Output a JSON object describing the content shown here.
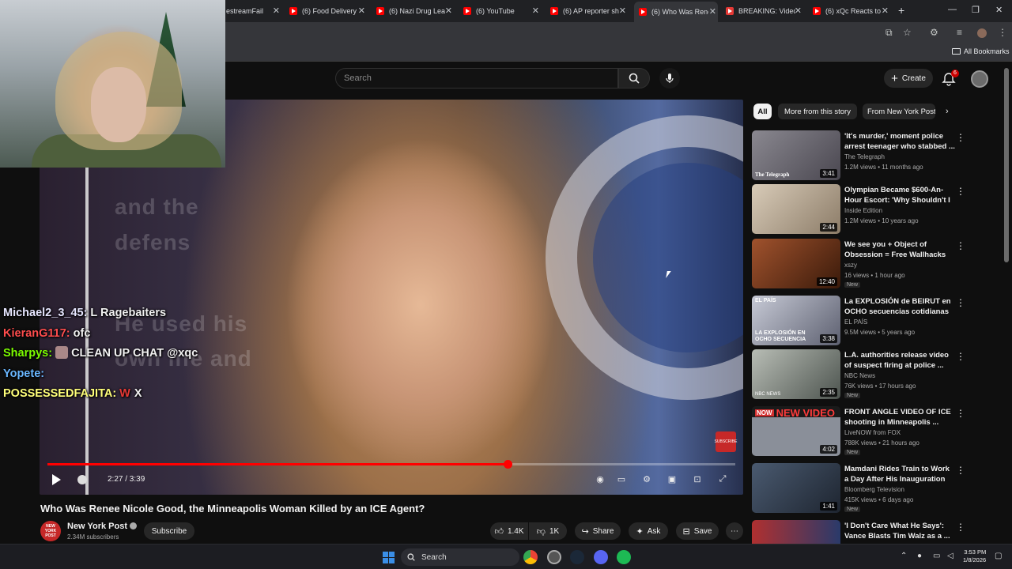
{
  "browser": {
    "tabs": [
      {
        "label": "estreamFail"
      },
      {
        "label": "(6) Food Delivery"
      },
      {
        "label": "(6) Nazi Drug Lea"
      },
      {
        "label": "(6) YouTube"
      },
      {
        "label": "(6) AP reporter sh"
      },
      {
        "label": "(6) Who Was Rene"
      },
      {
        "label": "BREAKING: Video"
      },
      {
        "label": "(6) xQc Reacts to"
      }
    ],
    "active_tab_index": 5,
    "bookmarks_label": "All Bookmarks"
  },
  "header": {
    "search_placeholder": "Search",
    "create_label": "Create",
    "notification_count": "6"
  },
  "player": {
    "time_display": "2:27 / 3:39",
    "progress": 0.67,
    "watermark": "SUBSCRIBE"
  },
  "chat": [
    {
      "user": "Michael2_3_45:",
      "user_color": "#e6e6ff",
      "message": "L Ragebaiters",
      "emote": false
    },
    {
      "user": "KieranG117:",
      "user_color": "#ff4d4d",
      "message": "ofc",
      "emote": false
    },
    {
      "user": "Sharpys:",
      "user_color": "#7cfc00",
      "message": "CLEAN UP CHAT @xqc",
      "emote": true
    },
    {
      "user": "Yopete:",
      "user_color": "#6ab7ff",
      "message": "",
      "emote": false
    },
    {
      "user": "POSSESSEDFAJITA:",
      "user_color": "#ffff7a",
      "message": "X",
      "emote_letter": "W"
    }
  ],
  "video": {
    "title": "Who Was Renee Nicole Good, the Minneapolis Woman Killed by an ICE Agent?",
    "channel": "New York Post",
    "channel_avatar_text": "NEW YORK POST",
    "subscribers": "2.34M subscribers",
    "subscribe_label": "Subscribe",
    "likes": "1.4K",
    "dislikes": "1K",
    "share_label": "Share",
    "ask_label": "Ask",
    "save_label": "Save"
  },
  "chips": [
    {
      "label": "All",
      "active": true
    },
    {
      "label": "More from this story",
      "active": false
    },
    {
      "label": "From New York Post",
      "active": false
    }
  ],
  "recommendations": [
    {
      "title": "'It's murder,' moment police arrest teenager who stabbed ...",
      "channel": "The Telegraph",
      "meta": "1.2M views • 11 months ago",
      "duration": "3:41",
      "new": false,
      "thumb_color": "#6d6a70"
    },
    {
      "title": "Olympian Became $600-An-Hour Escort: 'Why Shouldn't I ...",
      "channel": "Inside Edition",
      "meta": "1.2M views • 10 years ago",
      "duration": "2:44",
      "new": false,
      "thumb_color": "#b3a48f"
    },
    {
      "title": "We see you + Object of Obsession = Free Wallhacks :D...",
      "channel": "xszy",
      "meta": "16 views • 1 hour ago",
      "duration": "12:40",
      "new": true,
      "thumb_color": "#7a3a20"
    },
    {
      "title": "La EXPLOSIÓN de BEIRUT en OCHO secuencias cotidianas",
      "channel": "EL PAÍS",
      "meta": "9.5M views • 5 years ago",
      "duration": "3:38",
      "new": false,
      "thumb_color": "#8a8fa0"
    },
    {
      "title": "L.A. authorities release video of suspect firing at police ...",
      "channel": "NBC News",
      "meta": "76K views • 17 hours ago",
      "duration": "2:35",
      "new": true,
      "thumb_color": "#7d8580"
    },
    {
      "title": "FRONT ANGLE VIDEO OF ICE shooting in Minneapolis ...",
      "channel": "LiveNOW from FOX",
      "meta": "788K views • 21 hours ago",
      "duration": "4:02",
      "new": true,
      "thumb_color": "#555a66"
    },
    {
      "title": "Mamdani Rides Train to Work a Day After His Inauguration",
      "channel": "Bloomberg Television",
      "meta": "415K views • 6 days ago",
      "duration": "1:41",
      "new": true,
      "thumb_color": "#3a4a5a"
    },
    {
      "title": "'I Don't Care What He Says': Vance Blasts Tim Walz as a ...",
      "channel": "",
      "meta": "",
      "duration": "",
      "new": false,
      "thumb_color": "#4a3a40"
    }
  ],
  "rec_overlays": {
    "telegraph": "The Telegraph",
    "beirut": "LA EXPLOSIÓN EN OCHO SECUENCIA",
    "elpais": "EL PAÍS",
    "new_video": "NEW VIDEO",
    "nbc": "NBC NEWS"
  },
  "taskbar": {
    "search_label": "Search",
    "time": "3:53 PM",
    "date": "1/8/2026"
  }
}
